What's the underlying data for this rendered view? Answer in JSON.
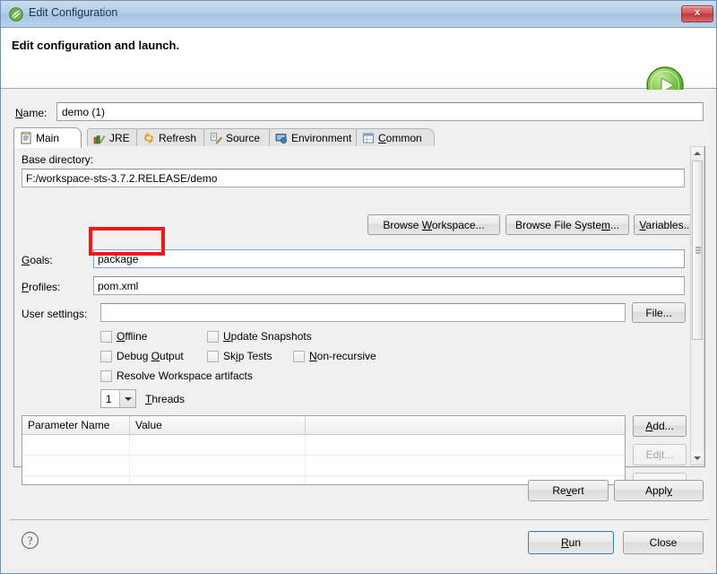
{
  "window": {
    "title": "Edit Configuration",
    "title_icon": "spring-leaf-icon",
    "close_label": "x",
    "accent_color": "#a6c3e2"
  },
  "header": {
    "heading": "Edit configuration and launch.",
    "run_badge_icon": "green-run-play-icon"
  },
  "name_field": {
    "label_pre": "N",
    "label_post": "ame:",
    "value": "demo (1)",
    "placeholder": ""
  },
  "tabs": [
    {
      "label": "Main",
      "icon": "main-document-icon",
      "active": true,
      "mnemonic": ""
    },
    {
      "label": "JRE",
      "icon": "jre-books-icon",
      "active": false,
      "mnemonic": ""
    },
    {
      "label": "Refresh",
      "icon": "refresh-arrows-icon",
      "active": false,
      "mnemonic": ""
    },
    {
      "label": "Source",
      "icon": "source-pencil-icon",
      "active": false,
      "mnemonic": ""
    },
    {
      "label": "Environment",
      "icon": "environment-monitor-icon",
      "active": false,
      "mnemonic": ""
    },
    {
      "label_pre": "C",
      "label_post": "ommon",
      "label": "Common",
      "icon": "common-table-icon",
      "active": false
    }
  ],
  "main_tab": {
    "base_directory": {
      "label": "Base directory:",
      "value": "F:/workspace-sts-3.7.2.RELEASE/demo"
    },
    "browse_buttons": [
      {
        "name": "browse-workspace-button",
        "pre": "Browse ",
        "mn": "W",
        "post": "orkspace..."
      },
      {
        "name": "browse-file-system-button",
        "pre": "Browse File Syste",
        "mn": "m",
        "post": "..."
      },
      {
        "name": "variables-button",
        "pre": "",
        "mn": "V",
        "post": "ariables..."
      }
    ],
    "goals": {
      "label_pre": "G",
      "label_post": "oals:",
      "value": "package",
      "highlighted": true,
      "highlight_color": "#fb1414"
    },
    "profiles": {
      "label_pre": "P",
      "label_post": "rofiles:",
      "value": "pom.xml"
    },
    "user_settings": {
      "label": "User settings:",
      "value": "",
      "file_button": "File..."
    },
    "checkboxes": [
      {
        "name": "offline-checkbox",
        "pre": "O",
        "post": "ffline",
        "checked": false
      },
      {
        "name": "update-snapshots-checkbox",
        "pre": "U",
        "post": "pdate Snapshots",
        "checked": false
      },
      {
        "name": "debug-output-checkbox",
        "pre": "Debug ",
        "mn": "O",
        "post": "utput",
        "checked": false
      },
      {
        "name": "skip-tests-checkbox",
        "pre": "Sk",
        "mn": "i",
        "post": "p Tests",
        "checked": false
      },
      {
        "name": "non-recursive-checkbox",
        "pre": "N",
        "post": "on-recursive",
        "checked": false
      },
      {
        "name": "resolve-workspace-artifacts-checkbox",
        "pre": "Resolve Workspace artifacts",
        "post": "",
        "checked": false
      }
    ],
    "threads": {
      "value": "1",
      "label_pre": "T",
      "label_post": "hreads"
    },
    "parameters_table": {
      "columns": [
        "Parameter Name",
        "Value",
        ""
      ],
      "rows": [],
      "empty_row_count": 3
    },
    "table_buttons": [
      {
        "name": "add-parameter-button",
        "pre": "A",
        "post": "dd...",
        "disabled": false
      },
      {
        "name": "edit-parameter-button",
        "pre": "Ed",
        "mn": "i",
        "post": "t...",
        "disabled": true
      }
    ]
  },
  "action_buttons": {
    "revert": {
      "pre": "Re",
      "mn": "v",
      "post": "ert"
    },
    "apply": {
      "pre": "Appl",
      "mn": "y",
      "post": ""
    }
  },
  "footer": {
    "help_icon": "question-mark-help-icon",
    "run": {
      "pre": "R",
      "post": "un",
      "default": true
    },
    "close": {
      "pre": "Close",
      "post": ""
    }
  }
}
